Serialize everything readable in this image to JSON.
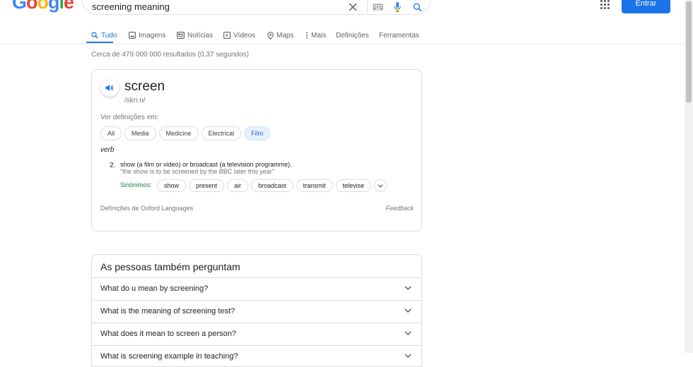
{
  "header": {
    "logo_letters": [
      "G",
      "o",
      "o",
      "g",
      "l",
      "e"
    ],
    "search_value": "screening meaning",
    "signin_label": "Entrar"
  },
  "tabs": [
    {
      "label": "Tudo",
      "icon": "search-icon",
      "active": true
    },
    {
      "label": "Imagens",
      "icon": "image-icon"
    },
    {
      "label": "Notícias",
      "icon": "news-icon"
    },
    {
      "label": "Vídeos",
      "icon": "video-icon"
    },
    {
      "label": "Maps",
      "icon": "map-pin-icon"
    },
    {
      "label": "Mais",
      "icon": "more-vert-icon"
    },
    {
      "label": "Definições"
    },
    {
      "label": "Ferramentas"
    }
  ],
  "result_stats": "Cerca de 479 000 000 resultados (0,37 segundos)",
  "dictionary": {
    "word": "screen",
    "phonetic": "/skriːn/",
    "ver_label": "Ver definições em:",
    "chips": [
      {
        "label": "All"
      },
      {
        "label": "Media"
      },
      {
        "label": "Medicine"
      },
      {
        "label": "Electrical"
      },
      {
        "label": "Film",
        "selected": true
      }
    ],
    "part_of_speech": "verb",
    "sense_number": "2.",
    "definition": "show (a film or video) or broadcast (a television programme).",
    "example": "\"the show is to be screened by the BBC later this year\"",
    "synonyms_label": "Sinónimos:",
    "synonyms": [
      "show",
      "present",
      "air",
      "broadcast",
      "transmit",
      "televise"
    ],
    "source": "Definições de Oxford Languages",
    "feedback": "Feedback"
  },
  "people_also_ask": {
    "title": "As pessoas também perguntam",
    "questions": [
      "What do u mean by screening?",
      "What is the meaning of screening test?",
      "What does it mean to screen a person?",
      "What is screening example in teaching?"
    ]
  },
  "colors": {
    "accent": "#1a73e8",
    "synonym_label": "#188038",
    "selected_chip_bg": "#e8f0fe"
  }
}
